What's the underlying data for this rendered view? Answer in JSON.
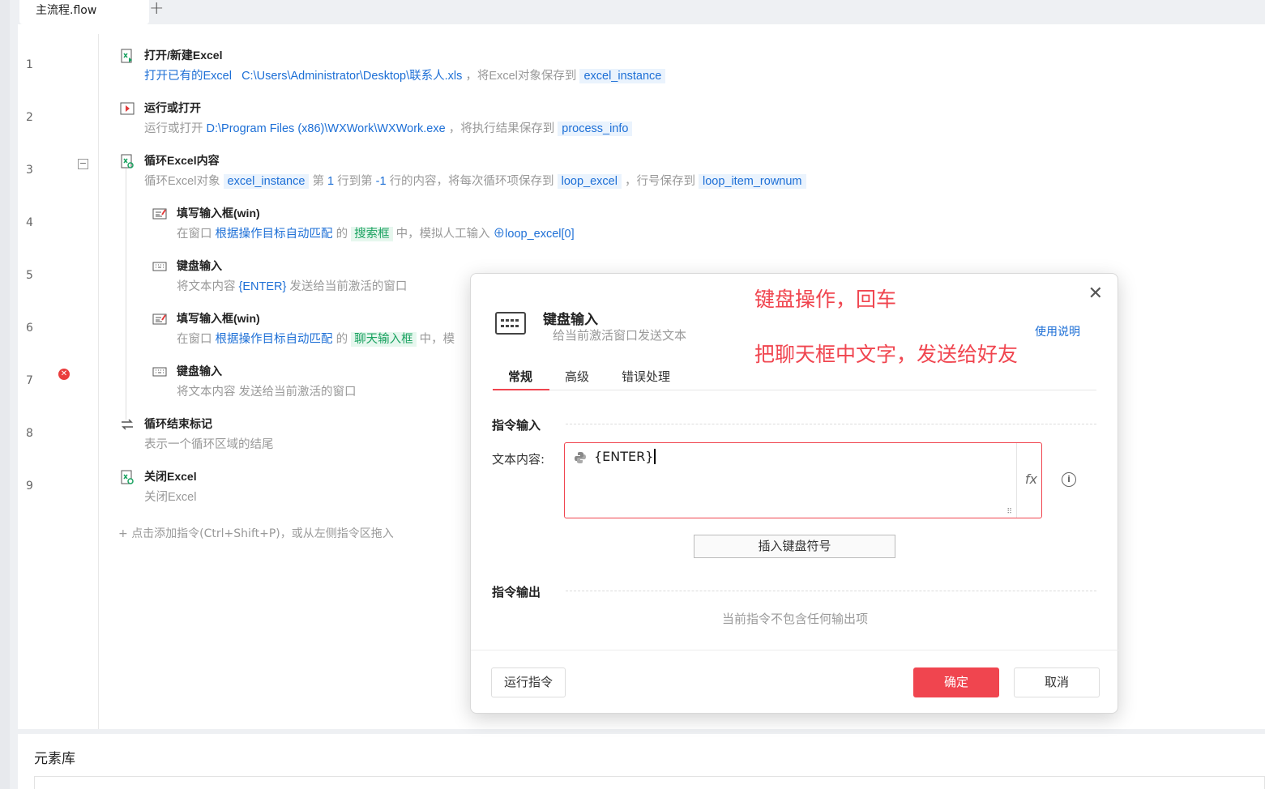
{
  "tab": {
    "label": "主流程.flow",
    "add": "+"
  },
  "rows": [
    {
      "num": "1",
      "title": "打开/新建Excel",
      "d": [
        "打开已有的Excel",
        "C:\\Users\\Administrator\\Desktop\\联系人.xls",
        "，将Excel对象保存到",
        "excel_instance"
      ]
    },
    {
      "num": "2",
      "title": "运行或打开",
      "d": [
        "运行或打开",
        "D:\\Program Files (x86)\\WXWork\\WXWork.exe",
        "，将执行结果保存到",
        "process_info"
      ]
    },
    {
      "num": "3",
      "title": "循环Excel内容",
      "d": [
        "循环Excel对象",
        "excel_instance",
        "第",
        "1",
        "行到第",
        "-1",
        "行的内容，将每次循环项保存到",
        "loop_excel",
        "，行号保存到",
        "loop_item_rownum"
      ]
    },
    {
      "num": "4",
      "title": "填写输入框(win)",
      "d": [
        "在窗口",
        "根据操作目标自动匹配",
        "的",
        "搜索框",
        "中，模拟人工输入",
        "loop_excel[0]"
      ]
    },
    {
      "num": "5",
      "title": "键盘输入",
      "d": [
        "将文本内容",
        "{ENTER}",
        "发送给当前激活的窗口"
      ]
    },
    {
      "num": "6",
      "title": "填写输入框(win)",
      "d": [
        "在窗口",
        "根据操作目标自动匹配",
        "的",
        "聊天输入框",
        "中，模"
      ]
    },
    {
      "num": "7",
      "title": "键盘输入",
      "d": [
        "将文本内容 发送给当前激活的窗口"
      ]
    },
    {
      "num": "8",
      "title": "循环结束标记",
      "d": [
        "表示一个循环区域的结尾"
      ]
    },
    {
      "num": "9",
      "title": "关闭Excel",
      "d": [
        "关闭Excel"
      ]
    }
  ],
  "add_hint": "点击添加指令(Ctrl+Shift+P)，或从左侧指令区拖入",
  "library": {
    "title": "元素库"
  },
  "dialog": {
    "title": "键盘输入",
    "subtitle": "给当前激活窗口发送文本",
    "help": "使用说明",
    "annotation1": "键盘操作，回车",
    "annotation2": "把聊天框中文字，发送给好友",
    "tabs": [
      "常规",
      "高级",
      "错误处理"
    ],
    "section_input": "指令输入",
    "field_label": "文本内容:",
    "field_value": "{ENTER}",
    "fx": "fx",
    "insert_button": "插入键盘符号",
    "section_output": "指令输出",
    "no_output": "当前指令不包含任何输出项",
    "run_button": "运行指令",
    "ok_button": "确定",
    "cancel_button": "取消"
  },
  "colors": {
    "accent": "#f0454f",
    "link": "#1d6fd6",
    "green": "#1aa260"
  }
}
